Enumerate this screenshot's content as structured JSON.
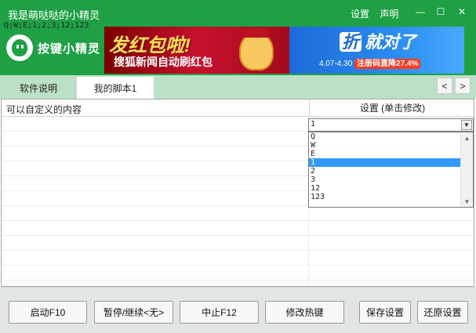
{
  "window": {
    "title": "我是萌哒哒的小精灵",
    "links": [
      "设置",
      "声明"
    ],
    "controls": {
      "minimize": "—",
      "maximize": "☐",
      "close": "✕"
    }
  },
  "brand": {
    "logo_text": "按键小精灵"
  },
  "banner": {
    "left_headline": "发红包啦!",
    "left_subline": "搜狐新闻自动刷红包",
    "right_headline_char": "折",
    "right_headline": "就对了",
    "right_dates": "4.07-4.30",
    "right_promo": "注册码直降27.4%"
  },
  "tabs": [
    {
      "label": "软件说明",
      "active": false
    },
    {
      "label": "我的脚本1",
      "active": true
    }
  ],
  "nav": {
    "prev": "<",
    "next": ">"
  },
  "grid": {
    "col1_header": "可以自定义的内容",
    "col2_header": "设置 (单击修改)",
    "row1_value": "Q;W;E;1;2;3;12;123",
    "selected_option": "1",
    "options": [
      "Q",
      "W",
      "E",
      "1",
      "2",
      "3",
      "12",
      "123"
    ],
    "selected_index": 3
  },
  "buttons": [
    "启动F10",
    "暂停/继续<无>",
    "中止F12",
    "修改热键",
    "保存设置",
    "还原设置"
  ],
  "colors": {
    "green": "#1fa045",
    "tab_bar": "#bce0c6",
    "selection": "#3399ff"
  }
}
